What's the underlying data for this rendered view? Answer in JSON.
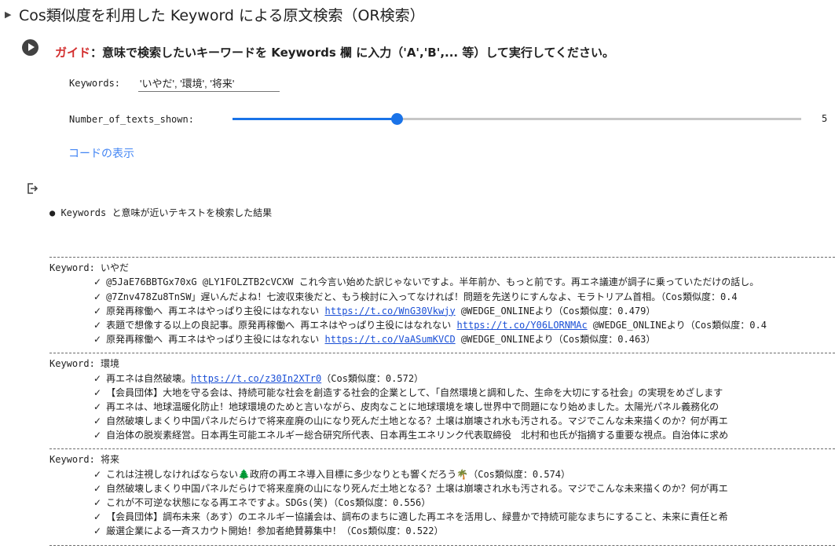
{
  "section": {
    "title": "Cos類似度を利用した Keyword による原文検索（OR検索）"
  },
  "guide": {
    "label": "ガイド",
    "text": "：意味で検索したいキーワードを Keywords 欄 に入力（'A','B',... 等）して実行してください。"
  },
  "form": {
    "keywords_label": "Keywords:",
    "keywords_value": "'いやだ', '環境', '将来'",
    "count_label": "Number_of_texts_shown:",
    "count_value": "5",
    "count_fraction": 0.29
  },
  "code_toggle": "コードの表示",
  "output": {
    "intro": "● Keywords と意味が近いテキストを検索した結果",
    "groups": [
      {
        "keyword": "Keyword: いやだ",
        "items": [
          {
            "before": "@5JaE76BBTGx70xG @LY1FOLZTB2cVCXW これ今言い始めた訳じゃないですよ。半年前か、もっと前です。再エネ議連が調子に乗っていただけの話し。"
          },
          {
            "before": "@7Znv478Zu8TnSW」遅いんだよね！七波収束後だと、もう検討に入ってなければ！問題を先送りにすんなよ、モラトリアム首相。（Cos類似度：0.4"
          },
          {
            "before": "原発再稼働へ 再エネはやっぱり主役にはなれない ",
            "link": "https://t.co/WnG30Vkwjy",
            "after": " @WEDGE_ONLINEより（Cos類似度：0.479）"
          },
          {
            "before": "表題で想像する以上の良記事。原発再稼働へ 再エネはやっぱり主役にはなれない ",
            "link": "https://t.co/Y06LORNMAc",
            "after": " @WEDGE_ONLINEより（Cos類似度：0.4"
          },
          {
            "before": "原発再稼働へ 再エネはやっぱり主役にはなれない ",
            "link": "https://t.co/VaASumKVCD",
            "after": " @WEDGE_ONLINEより（Cos類似度：0.463）"
          }
        ]
      },
      {
        "keyword": "Keyword: 環境",
        "items": [
          {
            "before": "再エネは自然破壊。",
            "link": "https://t.co/z30In2XTr0",
            "after": "（Cos類似度：0.572）"
          },
          {
            "before": "【会員団体】大地を守る会は、持続可能な社会を創造する社会的企業として、「自然環境と調和した、生命を大切にする社会」の実現をめざします"
          },
          {
            "before": "再エネは、地球温暖化防止！地球環境のためと言いながら、皮肉なことに地球環境を壊し世界中で問題になり始めました。太陽光パネル義務化の"
          },
          {
            "before": "自然破壊しまくり中国パネルだらけで将来産廃の山になり死んだ土地となる？土壌は崩壊され水も汚される。マジでこんな未来描くのか？何が再エ"
          },
          {
            "before": "自治体の脱炭素経営。日本再生可能エネルギー総合研究所代表、日本再生エネリンク代表取締役　北村和也氏が指摘する重要な視点。自治体に求め"
          }
        ]
      },
      {
        "keyword": "Keyword: 将来",
        "items": [
          {
            "before": "これは注視しなければならない🌲政府の再エネ導入目標に多少なりとも響くだろう🌴（Cos類似度：0.574）"
          },
          {
            "before": "自然破壊しまくり中国パネルだらけで将来産廃の山になり死んだ土地となる？土壌は崩壊され水も汚される。マジでこんな未来描くのか？何が再エ"
          },
          {
            "before": "これが不可逆な状態になる再エネですよ。SDGs(笑)（Cos類似度：0.556）"
          },
          {
            "before": "【会員団体】調布未来（あす）のエネルギー協議会は、調布のまちに適した再エネを活用し、緑豊かで持続可能なまちにすること、未来に責任と希"
          },
          {
            "before": "厳選企業による一斉スカウト開始！参加者絶賛募集中！（Cos類似度：0.522）"
          }
        ]
      }
    ]
  }
}
